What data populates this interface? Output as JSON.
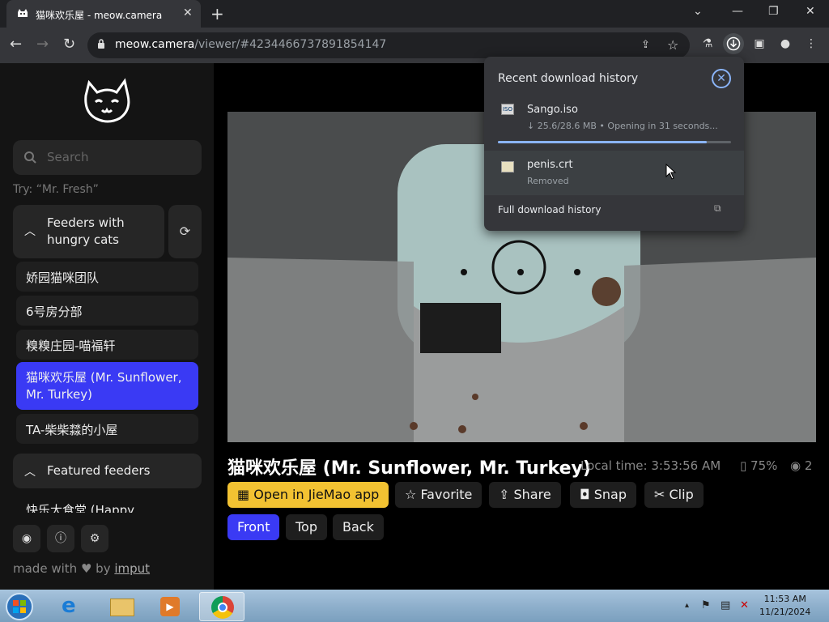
{
  "browser": {
    "tab_title": "猫咪欢乐屋 - meow.camera",
    "url_host": "meow.camera",
    "url_rest": "/viewer/#4234466737891854147"
  },
  "sidebar": {
    "search_placeholder": "Search",
    "try_text": "Try: “Mr. Fresh”",
    "group1_label": "Feeders with hungry cats",
    "items": [
      "娇园猫咪团队",
      "6号房分部",
      "糗糗庄园-喵福轩",
      "猫咪欢乐屋 (Mr. Sunflower, Mr. Turkey)",
      "TA-柴柴㵘的小屋"
    ],
    "group2_label": "Featured feeders",
    "group2_first": "快乐大食堂 (Happy",
    "made_with": "made with",
    "by": "by",
    "author": "imput"
  },
  "feeder": {
    "title": "猫咪欢乐屋 (Mr. Sunflower, Mr. Turkey)",
    "local_time": "Local time: 3:53:56 AM",
    "battery_label": "75%",
    "battery_level": 0.75,
    "viewers": "2",
    "actions": {
      "open": "Open in JieMao app",
      "favorite": "Favorite",
      "share": "Share",
      "snap": "Snap",
      "clip": "Clip"
    },
    "cameras": [
      "Front",
      "Top",
      "Back"
    ],
    "selected_camera": "Front"
  },
  "downloads": {
    "header": "Recent download history",
    "items": [
      {
        "name": "Sango.iso",
        "status": "↓ 25.6/28.6 MB • Opening in 31 seconds...",
        "progress": 0.895
      },
      {
        "name": "penis.crt",
        "status": "Removed"
      }
    ],
    "full_history": "Full download history"
  },
  "taskbar": {
    "time": "11:53 AM",
    "date": "11/21/2024"
  },
  "colors": {
    "accent": "#3a3af4",
    "yellow_button": "#f2c232",
    "download_accent": "#8ab4f8"
  }
}
